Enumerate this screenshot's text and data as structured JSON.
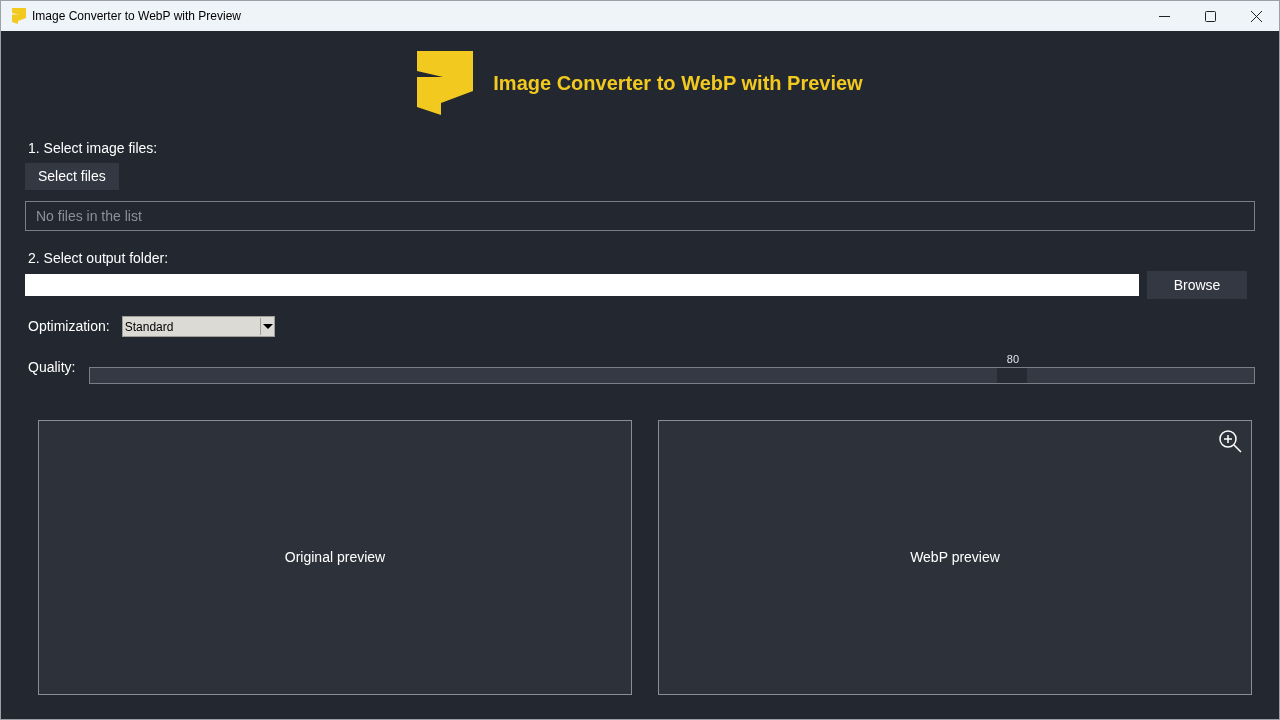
{
  "window": {
    "title": "Image Converter to WebP with Preview"
  },
  "header": {
    "title": "Image Converter to WebP with Preview"
  },
  "files": {
    "label": "1. Select image files:",
    "button": "Select files",
    "list_placeholder": "No files in the list"
  },
  "output": {
    "label": "2. Select output folder:",
    "button": "Browse"
  },
  "optimization": {
    "label": "Optimization:",
    "value": "Standard"
  },
  "quality": {
    "label": "Quality:",
    "reading": "80",
    "level": 0.8
  },
  "previews": [
    {
      "label": "Original preview",
      "zoom": false
    },
    {
      "label": "WebP preview",
      "zoom": true
    }
  ]
}
